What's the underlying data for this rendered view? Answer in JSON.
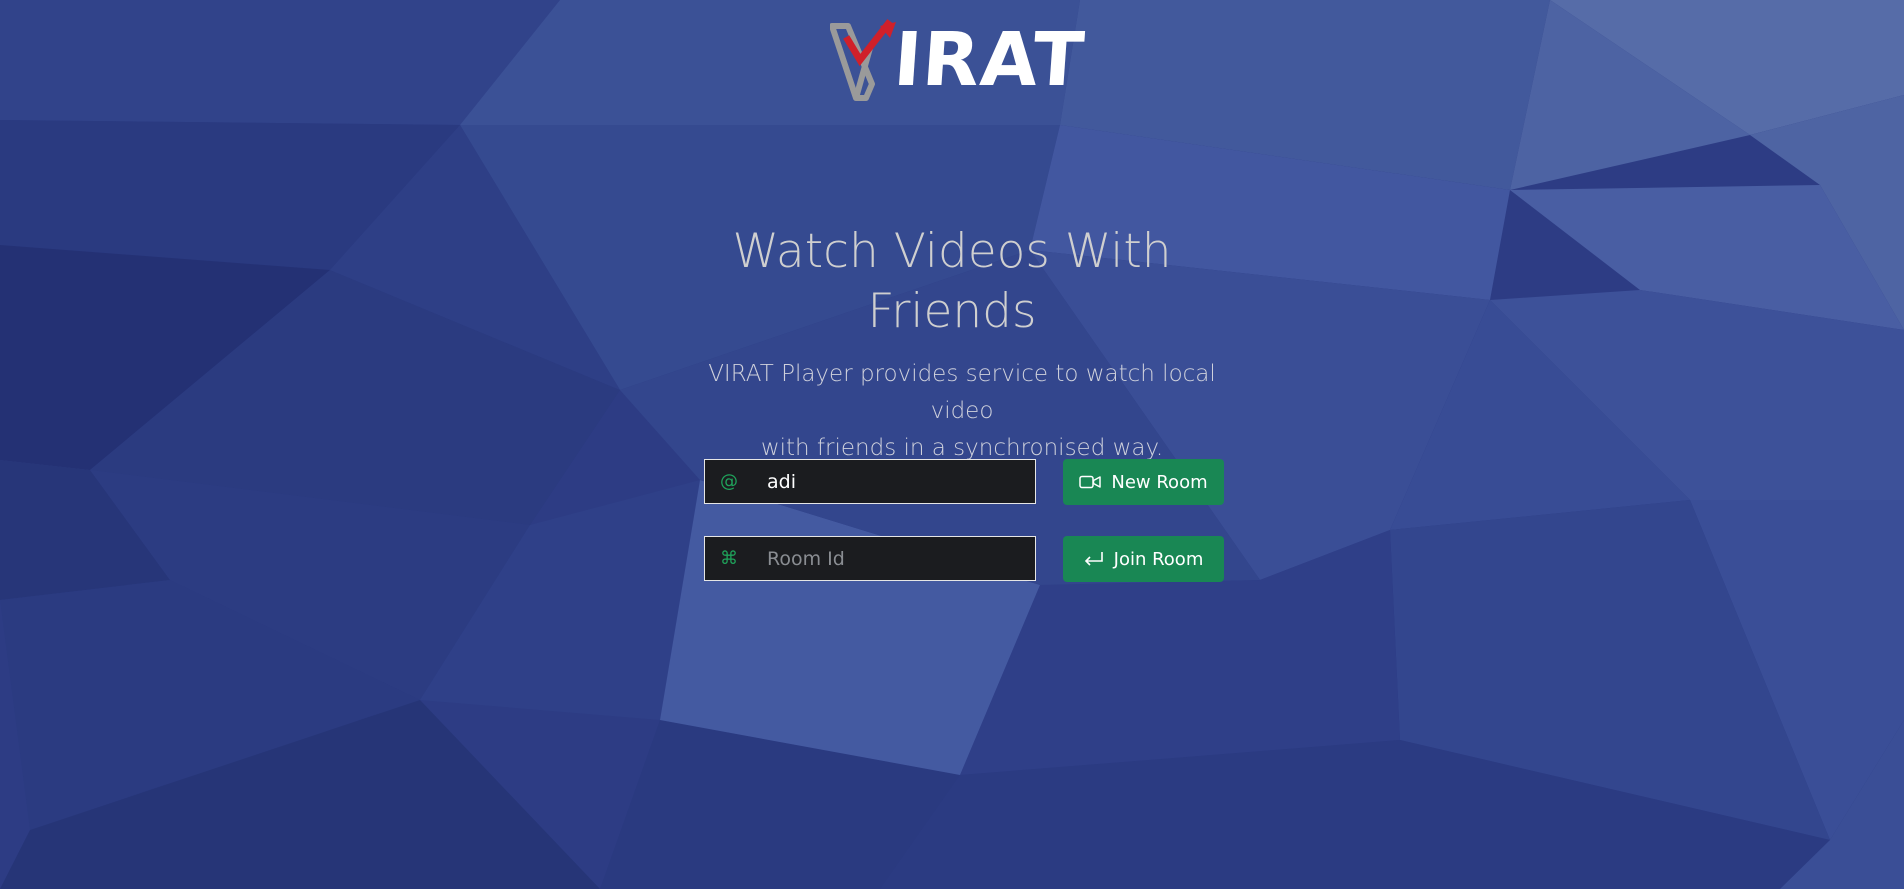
{
  "brand": {
    "logo_text": "IRAT",
    "logo_alt": "VIRAT"
  },
  "hero": {
    "title_line1": "Watch Videos With",
    "title_line2": "Friends",
    "description_line1": "VIRAT Player provides service to watch local video",
    "description_line2": "with friends in a synchronised way."
  },
  "form": {
    "username": {
      "icon": "at-icon",
      "prefix": "@",
      "value": "adi",
      "placeholder": ""
    },
    "room_id": {
      "icon": "command-icon",
      "prefix": "⌘",
      "value": "",
      "placeholder": "Room Id"
    },
    "new_room_button": {
      "label": "New Room",
      "icon": "video-camera-icon"
    },
    "join_room_button": {
      "label": "Join Room",
      "icon": "enter-arrow-icon"
    }
  },
  "colors": {
    "background": "#2c3d85",
    "accent_green": "#198754",
    "logo_red": "#d0202a",
    "logo_gray": "#9a9a9a",
    "input_bg": "#1b1c1f"
  }
}
